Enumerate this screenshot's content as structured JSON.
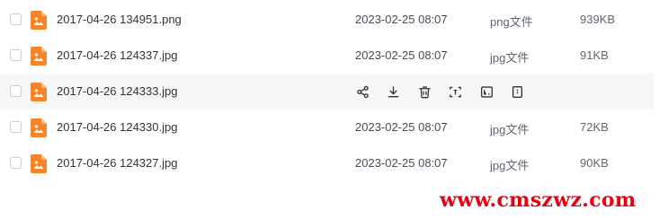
{
  "files": [
    {
      "name": "2017-04-26 134951.png",
      "modified": "2023-02-25 08:07",
      "type": "png文件",
      "size": "939KB"
    },
    {
      "name": "2017-04-26 124337.jpg",
      "modified": "2023-02-25 08:07",
      "type": "jpg文件",
      "size": "91KB"
    },
    {
      "name": "2017-04-26 124333.jpg",
      "modified": "",
      "type": "",
      "size": ""
    },
    {
      "name": "2017-04-26 124330.jpg",
      "modified": "2023-02-25 08:07",
      "type": "jpg文件",
      "size": "72KB"
    },
    {
      "name": "2017-04-26 124327.jpg",
      "modified": "2023-02-25 08:07",
      "type": "jpg文件",
      "size": "90KB"
    }
  ],
  "hover_actions": [
    {
      "icon": "share-icon"
    },
    {
      "icon": "download-icon"
    },
    {
      "icon": "delete-icon"
    },
    {
      "icon": "scan-icon"
    },
    {
      "icon": "text-extract-icon"
    },
    {
      "icon": "more-icon"
    }
  ],
  "colors": {
    "file_icon": "#f7842b",
    "hover_row": "#f6f7f9",
    "watermark": "#e60012"
  },
  "watermark": {
    "text": "www.cmszwz.com"
  }
}
